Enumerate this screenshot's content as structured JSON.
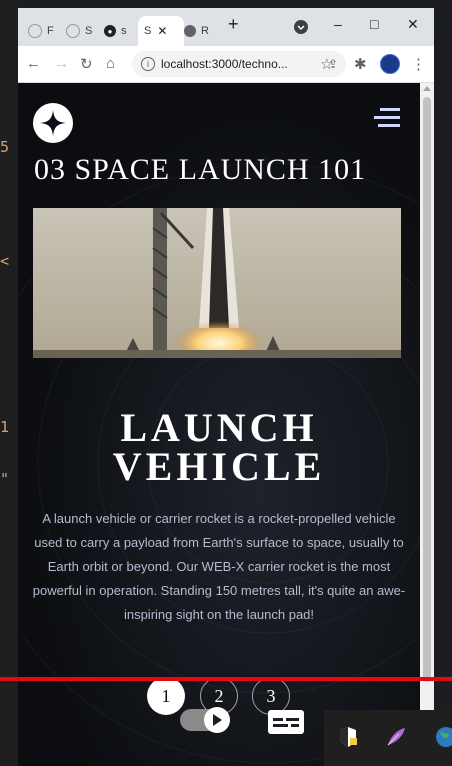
{
  "browser": {
    "tabs": [
      {
        "label": "F",
        "active": false
      },
      {
        "label": "S",
        "active": false
      },
      {
        "label": "s",
        "active": false
      },
      {
        "label": "S",
        "active": true
      },
      {
        "label": "R",
        "active": false
      }
    ],
    "new_tab": "+",
    "url": "localhost:3000/techno...",
    "window_controls": [
      "–",
      "□",
      "✕"
    ]
  },
  "page": {
    "title": "03 SPACE LAUNCH 101",
    "heading_line1": "LAUNCH",
    "heading_line2": "VEHICLE",
    "description": "A launch vehicle or carrier rocket is a rocket-propelled vehicle used to carry a payload from Earth's surface to space, usually to Earth orbit or beyond. Our WEB-X carrier rocket is the most powerful in operation. Standing 150 metres tall, it's quite an awe-inspiring sight on the launch pad!",
    "pager": [
      "1",
      "2",
      "3"
    ],
    "active_page": "1"
  },
  "editor_glyphs": [
    "5",
    "<",
    "1",
    "\""
  ],
  "colors": {
    "background": "#0b0d17",
    "text_light": "#d0d6f9",
    "progress": "#e50914"
  },
  "icons": {
    "logo": "star-logo-icon",
    "menu": "hamburger-icon",
    "cc": "captions-icon",
    "shield": "shield-icon",
    "feather": "feather-icon",
    "globe": "globe-icon"
  }
}
